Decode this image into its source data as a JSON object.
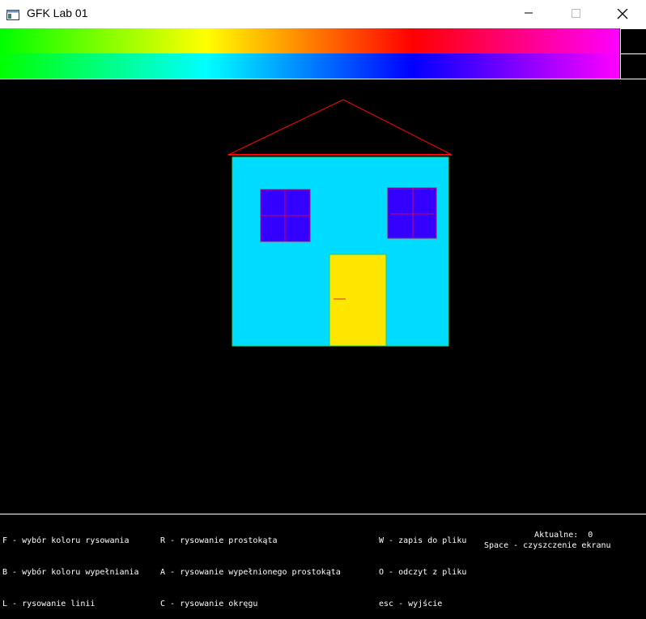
{
  "window": {
    "title": "GFK Lab 01",
    "controls": [
      "minimize",
      "maximize",
      "close"
    ]
  },
  "palette": {
    "top_gradient": [
      "#00ff00",
      "#ffff00",
      "#ff0000",
      "#ff00ff"
    ],
    "bottom_gradient": [
      "#00ff00",
      "#00ffff",
      "#0000ff",
      "#ff00ff"
    ],
    "selected_draw_color": "#000000",
    "selected_fill_color": "#000000"
  },
  "drawing": {
    "background": "#000000",
    "roof_color": "#ff0000",
    "wall_color": "#00dcff",
    "window_color": "#3300ff",
    "door_color": "#ffe600",
    "line_color": "#cc0066"
  },
  "help": {
    "col1": [
      "F - wybór koloru rysowania",
      "B - wybór koloru wypełniania",
      "L - rysowanie linii"
    ],
    "col2": [
      "R - rysowanie prostokąta",
      "A - rysowanie wypełnionego prostokąta",
      "C - rysowanie okręgu"
    ],
    "col3": [
      "W - zapis do pliku",
      "O - odczyt z pliku",
      "esc - wyjście"
    ],
    "current_label": "Aktualne:",
    "current_value": "0",
    "space_hint": "Space - czyszczenie ekranu"
  }
}
